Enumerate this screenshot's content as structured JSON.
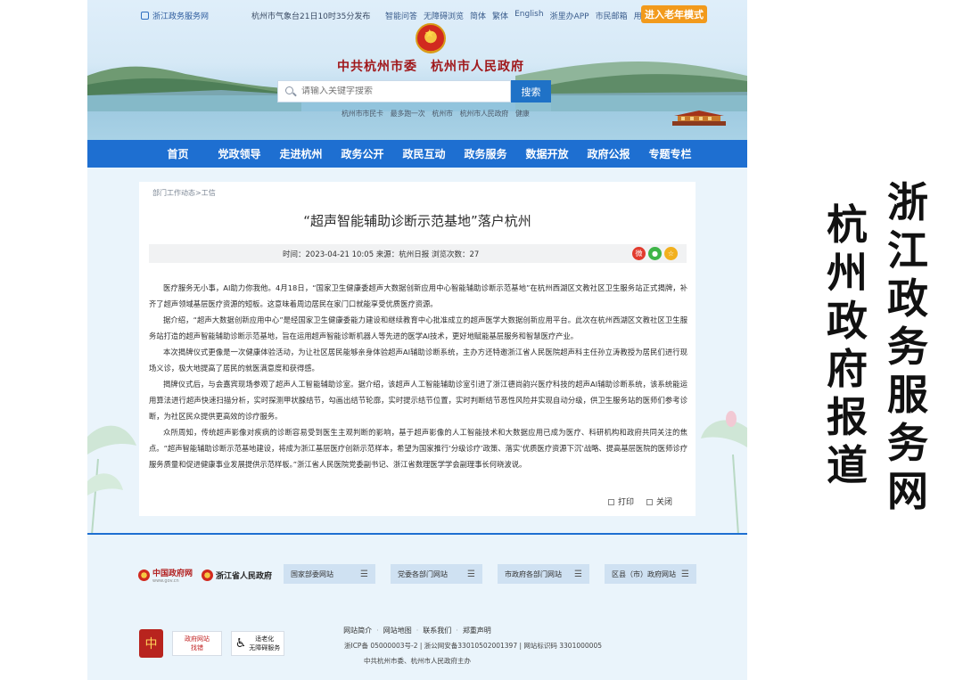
{
  "topbar": {
    "brand": "浙江政务服务网",
    "weather": "杭州市气象台21日10时35分发布",
    "links": [
      "智能问答",
      "无障碍浏览",
      "简体",
      "繁体",
      "English",
      "浙里办APP",
      "市民邮箱",
      "用户中心"
    ],
    "elder_mode": "进入老年模式"
  },
  "banner": {
    "site_title": "中共杭州市委　杭州市人民政府",
    "search_placeholder": "请输入关键字搜索",
    "search_button": "搜索",
    "hot_links": "杭州市市民卡　最多跑一次　杭州市　杭州市人民政府　健康"
  },
  "nav": {
    "items": [
      "首页",
      "党政领导",
      "走进杭州",
      "政务公开",
      "政民互动",
      "政务服务",
      "数据开放",
      "政府公报",
      "专题专栏"
    ]
  },
  "article": {
    "breadcrumb": "部门工作动态>工信",
    "title": "“超声智能辅助诊断示范基地”落户杭州",
    "meta": "时间：2023-04-21 10:05 来源：杭州日报 浏览次数：27",
    "paragraphs": [
      "医疗服务无小事，AI助力你我他。4月18日，“国家卫生健康委超声大数据创新应用中心智能辅助诊断示范基地”在杭州西湖区文教社区卫生服务站正式揭牌，补齐了超声领域基层医疗资源的短板。这意味着周边居民在家门口就能享受优质医疗资源。",
      "据介绍，“超声大数据创新应用中心”是经国家卫生健康委能力建设和继续教育中心批准成立的超声医学大数据创新应用平台。此次在杭州西湖区文教社区卫生服务站打造的超声智能辅助诊断示范基地，旨在运用超声智能诊断机器人等先进的医学AI技术，更好地赋能基层服务和智慧医疗产业。",
      "本次揭牌仪式更像是一次健康体验活动，为让社区居民能够亲身体验超声AI辅助诊断系统，主办方还特邀浙江省人民医院超声科主任孙立涛教授为居民们进行现场义诊，极大地提高了居民的就医满意度和获得感。",
      "揭牌仪式后，与会嘉宾现场参观了超声人工智能辅助诊室。据介绍，该超声人工智能辅助诊室引进了浙江德尚韵兴医疗科技的超声AI辅助诊断系统，该系统能运用算法进行超声快速扫描分析，实时探测甲状腺结节，勾画出结节轮廓，实时提示结节位置，实时判断结节恶性风险并实现自动分级，供卫生服务站的医师们参考诊断，为社区民众提供更高效的诊疗服务。",
      "众所周知，传统超声影像对疾病的诊断容易受到医生主观判断的影响，基于超声影像的人工智能技术和大数据应用已成为医疗、科研机构和政府共同关注的焦点。“超声智能辅助诊断示范基地建设，将成为浙江基层医疗创新示范样本，希望为国家推行‘分级诊疗’政策、落实‘优质医疗资源下沉’战略、提高基层医院的医师诊疗服务质量和促进健康事业发展提供示范样板。”浙江省人民医院党委副书记、浙江省数理医学学会副理事长何晓波说。"
    ],
    "print": "打印",
    "close": "关闭"
  },
  "footer": {
    "gov_logo_1": "中国政府网",
    "gov_logo_1_sub": "www.gov.cn",
    "gov_logo_2": "浙江省人民政府",
    "selects": [
      "国家部委网站",
      "党委各部门网站",
      "市政府各部门网站",
      "区县（市）政府网站"
    ],
    "links": [
      "网站简介",
      "网站地图",
      "联系我们",
      "郑重声明"
    ],
    "icp": "浙ICP备 05000003号-2 | 浙公网安备33010502001397 | 网站标识码 3301000005",
    "host": "中共杭州市委、杭州市人民政府主办",
    "badge_party": "党政机关",
    "badge_gov_1": "政府网站",
    "badge_gov_2": "找错",
    "badge_access_1": "适老化",
    "badge_access_2": "无障碍服务"
  },
  "caption": {
    "right": "浙江政务服务网",
    "left": "杭州政府报道"
  },
  "colors": {
    "nav_blue": "#1e6fd1",
    "elder_orange": "#f29a1c",
    "title_red": "#a0181b"
  }
}
